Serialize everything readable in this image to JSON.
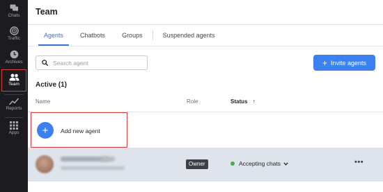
{
  "sidebar": {
    "items": [
      {
        "label": "Chats",
        "icon": "chat-icon"
      },
      {
        "label": "Traffic",
        "icon": "traffic-icon"
      },
      {
        "label": "Archives",
        "icon": "clock-icon"
      },
      {
        "label": "Team",
        "icon": "team-icon",
        "active": true
      },
      {
        "label": "Reports",
        "icon": "reports-icon"
      },
      {
        "label": "Apps",
        "icon": "apps-grid-icon"
      }
    ]
  },
  "header": {
    "title": "Team"
  },
  "tabs": [
    {
      "label": "Agents",
      "active": true
    },
    {
      "label": "Chatbots"
    },
    {
      "label": "Groups"
    },
    {
      "label": "Suspended agents"
    }
  ],
  "search": {
    "placeholder": "Search agent",
    "value": ""
  },
  "invite": {
    "label": "Invite agents"
  },
  "section": {
    "title": "Active (1)"
  },
  "table": {
    "columns": {
      "name": "Name",
      "role": "Role",
      "status": "Status",
      "sort_icon": "↑"
    }
  },
  "add_agent": {
    "label": "Add new agent"
  },
  "agents": [
    {
      "role": "Owner",
      "status": "Accepting chats",
      "more": "•••"
    }
  ],
  "colors": {
    "accent": "#3b82f0",
    "sidebar_bg": "#1b1b20",
    "highlight": "#d93a3a",
    "status_online": "#43b04a",
    "row_selected": "#dfe4ec"
  }
}
